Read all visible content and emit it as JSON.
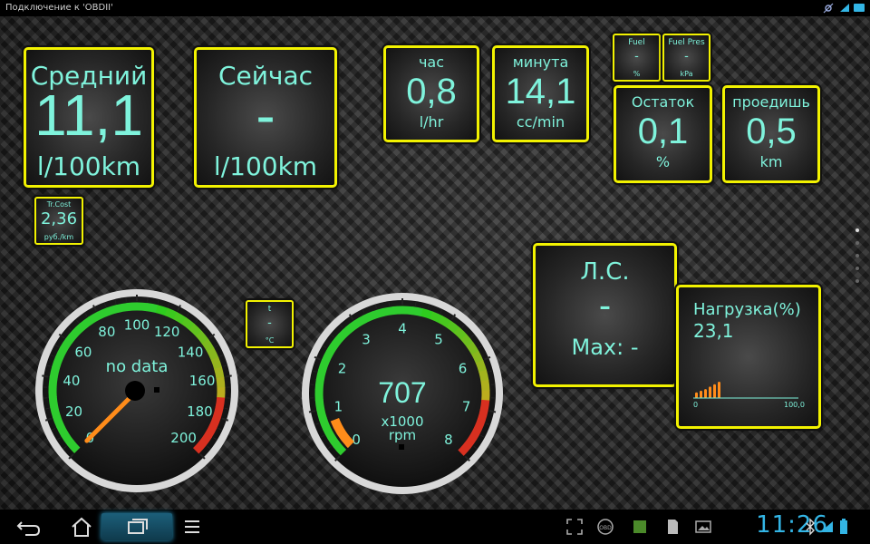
{
  "statusbar": {
    "title": "Подключение к 'OBDII'",
    "icons": [
      "gps-off-icon",
      "wifi-icon",
      "battery-icon"
    ]
  },
  "panels": {
    "avg": {
      "label": "Средний",
      "value": "11,1",
      "unit": "l/100km"
    },
    "now": {
      "label": "Сейчас",
      "value": "-",
      "unit": "l/100km"
    },
    "hour": {
      "label": "час",
      "value": "0,8",
      "unit": "l/hr"
    },
    "minute": {
      "label": "минута",
      "value": "14,1",
      "unit": "cc/min"
    },
    "fuel": {
      "label": "Fuel",
      "value": "-",
      "unit": "%"
    },
    "fuel_pres": {
      "label": "Fuel Pres",
      "value": "-",
      "unit": "kPa"
    },
    "remain": {
      "label": "Остаток",
      "value": "0,1",
      "unit": "%"
    },
    "range": {
      "label": "проедишь",
      "value": "0,5",
      "unit": "km"
    },
    "trip_cost": {
      "label": "Tr.Cost",
      "value": "2,36",
      "unit": "руб./km"
    },
    "temp": {
      "label": "t",
      "value": "-",
      "unit": "°C"
    },
    "hp": {
      "label": "Л.С.",
      "value": "-",
      "unit": "Max: -"
    },
    "load": {
      "label": "Нагрузка(%)",
      "value": "23,1",
      "axis_min": "0",
      "axis_max": "100,0",
      "history_levels": [
        0.35,
        0.45,
        0.55,
        0.7,
        0.85,
        1.0
      ]
    }
  },
  "speed_gauge": {
    "status": "no data",
    "min": 0,
    "max": 200,
    "value": 0,
    "ticks": [
      "0",
      "20",
      "40",
      "60",
      "80",
      "100",
      "120",
      "140",
      "160",
      "180",
      "200"
    ]
  },
  "rpm_gauge": {
    "value": "707",
    "unit1": "x1000",
    "unit2": "rpm",
    "min": 0,
    "max": 8,
    "reading": 0.707,
    "ticks": [
      "0",
      "1",
      "2",
      "3",
      "4",
      "5",
      "6",
      "7",
      "8"
    ]
  },
  "navbar": {
    "buttons": [
      "back-icon",
      "home-icon",
      "recent-apps-icon",
      "menu-icon"
    ],
    "clock": "11:26",
    "tray": [
      "fullscreen-icon",
      "obd-icon",
      "android-icon",
      "sd-card-icon",
      "gallery-icon",
      "bluetooth-icon",
      "wifi-icon",
      "battery-icon"
    ]
  },
  "colors": {
    "accent": "#7ff3dc",
    "frame": "#f2f200",
    "needle": "#ff8c1a"
  }
}
